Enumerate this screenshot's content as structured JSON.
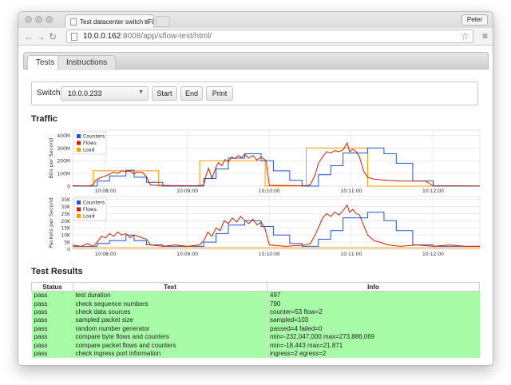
{
  "browser": {
    "tab_title": "Test datacenter switch sFlo",
    "user_button": "Peter",
    "url_host": "10.0.0.162",
    "url_path": ":8008/app/sflow-test/html/"
  },
  "page_tabs": [
    {
      "label": "Tests",
      "active": true
    },
    {
      "label": "Instructions",
      "active": false
    }
  ],
  "controls": {
    "switch_label": "Switch",
    "switch_value": "10.0.0.233",
    "start_label": "Start",
    "end_label": "End",
    "print_label": "Print"
  },
  "traffic_heading": "Traffic",
  "results_heading": "Test Results",
  "chart_data": [
    {
      "type": "line",
      "ylabel": "Bits per Second",
      "ylim": [
        0,
        440
      ],
      "yticks": [
        {
          "v": 0,
          "label": "0"
        },
        {
          "v": 100,
          "label": "100M"
        },
        {
          "v": 200,
          "label": "200M"
        },
        {
          "v": 300,
          "label": "300M"
        },
        {
          "v": 400,
          "label": "400M"
        }
      ],
      "xlim": [
        0,
        497
      ],
      "xticks": [
        {
          "v": 40,
          "label": "10:08:00"
        },
        {
          "v": 140,
          "label": "10:09:00"
        },
        {
          "v": 240,
          "label": "10:10:00"
        },
        {
          "v": 340,
          "label": "10:11:00"
        },
        {
          "v": 440,
          "label": "10:12:00"
        }
      ],
      "legend": "top-left",
      "series": [
        {
          "name": "Counters",
          "color": "#2255cc",
          "points": [
            [
              0,
              0
            ],
            [
              30,
              0
            ],
            [
              30,
              40
            ],
            [
              45,
              40
            ],
            [
              45,
              80
            ],
            [
              65,
              80
            ],
            [
              65,
              125
            ],
            [
              75,
              125
            ],
            [
              75,
              70
            ],
            [
              90,
              70
            ],
            [
              90,
              30
            ],
            [
              110,
              30
            ],
            [
              110,
              0
            ],
            [
              160,
              0
            ],
            [
              160,
              60
            ],
            [
              175,
              60
            ],
            [
              175,
              135
            ],
            [
              190,
              135
            ],
            [
              190,
              220
            ],
            [
              210,
              220
            ],
            [
              210,
              255
            ],
            [
              230,
              255
            ],
            [
              230,
              200
            ],
            [
              245,
              200
            ],
            [
              245,
              120
            ],
            [
              265,
              120
            ],
            [
              265,
              45
            ],
            [
              280,
              45
            ],
            [
              280,
              0
            ],
            [
              300,
              0
            ],
            [
              300,
              90
            ],
            [
              315,
              90
            ],
            [
              315,
              160
            ],
            [
              330,
              160
            ],
            [
              330,
              260
            ],
            [
              360,
              260
            ],
            [
              360,
              300
            ],
            [
              380,
              300
            ],
            [
              380,
              255
            ],
            [
              395,
              255
            ],
            [
              395,
              180
            ],
            [
              415,
              180
            ],
            [
              415,
              40
            ],
            [
              440,
              40
            ],
            [
              440,
              0
            ],
            [
              497,
              0
            ]
          ]
        },
        {
          "name": "Flows",
          "color": "#cc2200",
          "points": [
            [
              0,
              3
            ],
            [
              20,
              2
            ],
            [
              25,
              10
            ],
            [
              28,
              45
            ],
            [
              35,
              70
            ],
            [
              40,
              80
            ],
            [
              45,
              95
            ],
            [
              50,
              110
            ],
            [
              55,
              100
            ],
            [
              60,
              120
            ],
            [
              65,
              115
            ],
            [
              70,
              118
            ],
            [
              75,
              95
            ],
            [
              78,
              110
            ],
            [
              85,
              108
            ],
            [
              90,
              75
            ],
            [
              95,
              8
            ],
            [
              125,
              4
            ],
            [
              150,
              3
            ],
            [
              160,
              8
            ],
            [
              163,
              90
            ],
            [
              166,
              140
            ],
            [
              170,
              60
            ],
            [
              175,
              150
            ],
            [
              178,
              185
            ],
            [
              182,
              160
            ],
            [
              186,
              210
            ],
            [
              190,
              190
            ],
            [
              194,
              230
            ],
            [
              198,
              215
            ],
            [
              202,
              240
            ],
            [
              206,
              225
            ],
            [
              210,
              250
            ],
            [
              215,
              220
            ],
            [
              220,
              240
            ],
            [
              225,
              205
            ],
            [
              230,
              230
            ],
            [
              236,
              200
            ],
            [
              240,
              6
            ],
            [
              270,
              4
            ],
            [
              285,
              3
            ],
            [
              290,
              10
            ],
            [
              296,
              90
            ],
            [
              300,
              180
            ],
            [
              305,
              230
            ],
            [
              310,
              270
            ],
            [
              315,
              260
            ],
            [
              320,
              280
            ],
            [
              325,
              270
            ],
            [
              330,
              285
            ],
            [
              335,
              340
            ],
            [
              338,
              270
            ],
            [
              342,
              290
            ],
            [
              346,
              270
            ],
            [
              350,
              230
            ],
            [
              355,
              120
            ],
            [
              360,
              70
            ],
            [
              368,
              55
            ],
            [
              375,
              50
            ],
            [
              385,
              45
            ],
            [
              400,
              40
            ],
            [
              430,
              40
            ],
            [
              440,
              3
            ],
            [
              497,
              2
            ]
          ]
        },
        {
          "name": "Load",
          "color": "#ff9900",
          "points": [
            [
              0,
              0
            ],
            [
              25,
              0
            ],
            [
              25,
              120
            ],
            [
              105,
              120
            ],
            [
              105,
              0
            ],
            [
              155,
              0
            ],
            [
              155,
              200
            ],
            [
              235,
              200
            ],
            [
              235,
              0
            ],
            [
              285,
              0
            ],
            [
              285,
              300
            ],
            [
              360,
              300
            ],
            [
              360,
              0
            ],
            [
              497,
              0
            ]
          ]
        }
      ]
    },
    {
      "type": "line",
      "ylabel": "Packets per Second",
      "ylim": [
        0,
        37
      ],
      "yticks": [
        {
          "v": 0,
          "label": "0"
        },
        {
          "v": 5,
          "label": "5K"
        },
        {
          "v": 10,
          "label": "10K"
        },
        {
          "v": 15,
          "label": "15K"
        },
        {
          "v": 20,
          "label": "20K"
        },
        {
          "v": 25,
          "label": "25K"
        },
        {
          "v": 30,
          "label": "30K"
        },
        {
          "v": 35,
          "label": "35K"
        }
      ],
      "xlim": [
        0,
        497
      ],
      "xticks": [
        {
          "v": 40,
          "label": "10:08:00"
        },
        {
          "v": 140,
          "label": "10:09:00"
        },
        {
          "v": 240,
          "label": "10:10:00"
        },
        {
          "v": 340,
          "label": "10:11:00"
        },
        {
          "v": 440,
          "label": "10:12:00"
        }
      ],
      "legend": "top-left",
      "series": [
        {
          "name": "Counters",
          "color": "#2255cc",
          "points": [
            [
              0,
              2
            ],
            [
              30,
              2
            ],
            [
              30,
              4
            ],
            [
              45,
              4
            ],
            [
              45,
              6
            ],
            [
              65,
              6
            ],
            [
              65,
              10
            ],
            [
              75,
              10
            ],
            [
              75,
              6
            ],
            [
              90,
              6
            ],
            [
              90,
              3
            ],
            [
              110,
              3
            ],
            [
              110,
              2
            ],
            [
              160,
              2
            ],
            [
              160,
              5
            ],
            [
              175,
              5
            ],
            [
              175,
              11
            ],
            [
              190,
              11
            ],
            [
              190,
              17
            ],
            [
              210,
              17
            ],
            [
              210,
              20
            ],
            [
              230,
              20
            ],
            [
              230,
              16
            ],
            [
              245,
              16
            ],
            [
              245,
              10
            ],
            [
              265,
              10
            ],
            [
              265,
              4
            ],
            [
              280,
              4
            ],
            [
              280,
              2
            ],
            [
              300,
              2
            ],
            [
              300,
              7
            ],
            [
              315,
              7
            ],
            [
              315,
              13
            ],
            [
              330,
              13
            ],
            [
              330,
              22
            ],
            [
              360,
              22
            ],
            [
              360,
              26
            ],
            [
              380,
              26
            ],
            [
              380,
              20
            ],
            [
              395,
              20
            ],
            [
              395,
              13
            ],
            [
              415,
              13
            ],
            [
              415,
              3
            ],
            [
              440,
              3
            ],
            [
              440,
              2
            ],
            [
              497,
              2
            ]
          ]
        },
        {
          "name": "Flows",
          "color": "#cc2200",
          "points": [
            [
              0,
              3
            ],
            [
              10,
              2
            ],
            [
              18,
              4
            ],
            [
              25,
              2
            ],
            [
              30,
              5
            ],
            [
              35,
              9
            ],
            [
              40,
              8
            ],
            [
              45,
              11
            ],
            [
              50,
              9
            ],
            [
              55,
              12
            ],
            [
              60,
              10
            ],
            [
              65,
              11
            ],
            [
              70,
              8
            ],
            [
              75,
              10
            ],
            [
              80,
              9
            ],
            [
              90,
              7
            ],
            [
              95,
              3
            ],
            [
              110,
              2
            ],
            [
              125,
              3
            ],
            [
              140,
              2
            ],
            [
              155,
              3
            ],
            [
              160,
              6
            ],
            [
              165,
              12
            ],
            [
              170,
              9
            ],
            [
              175,
              15
            ],
            [
              180,
              13
            ],
            [
              185,
              20
            ],
            [
              190,
              18
            ],
            [
              195,
              22
            ],
            [
              200,
              19
            ],
            [
              205,
              23
            ],
            [
              210,
              20
            ],
            [
              215,
              18
            ],
            [
              220,
              21
            ],
            [
              225,
              17
            ],
            [
              230,
              19
            ],
            [
              235,
              14
            ],
            [
              240,
              3
            ],
            [
              260,
              2
            ],
            [
              285,
              3
            ],
            [
              290,
              4
            ],
            [
              296,
              10
            ],
            [
              300,
              15
            ],
            [
              305,
              22
            ],
            [
              310,
              25
            ],
            [
              315,
              23
            ],
            [
              320,
              26
            ],
            [
              325,
              24
            ],
            [
              330,
              27
            ],
            [
              335,
              31
            ],
            [
              338,
              26
            ],
            [
              342,
              28
            ],
            [
              346,
              25
            ],
            [
              350,
              24
            ],
            [
              355,
              17
            ],
            [
              360,
              10
            ],
            [
              368,
              6
            ],
            [
              375,
              5
            ],
            [
              385,
              3
            ],
            [
              400,
              2
            ],
            [
              420,
              3
            ],
            [
              440,
              2
            ],
            [
              460,
              3
            ],
            [
              480,
              2
            ],
            [
              497,
              2
            ]
          ]
        },
        {
          "name": "Load",
          "color": "#ff9900",
          "points": [
            [
              0,
              1
            ],
            [
              497,
              1
            ]
          ]
        }
      ]
    }
  ],
  "results_table": {
    "headers": [
      "Status",
      "Test",
      "Info"
    ],
    "rows": [
      {
        "status": "pass",
        "test": "test duration",
        "info": "497"
      },
      {
        "status": "pass",
        "test": "check sequence numbers",
        "info": "790"
      },
      {
        "status": "pass",
        "test": "check data sources",
        "info": "counter=53 flow=2"
      },
      {
        "status": "pass",
        "test": "sampled packet size",
        "info": "sampled=103"
      },
      {
        "status": "pass",
        "test": "random number generator",
        "info": "passed=4 failed=0"
      },
      {
        "status": "pass",
        "test": "compare byte flows and counters",
        "info": "min=-232,047,000 max=273,886,069"
      },
      {
        "status": "pass",
        "test": "compare packet flows and counters",
        "info": "min=-18,443 max=21,871"
      },
      {
        "status": "pass",
        "test": "check ingress port information",
        "info": "ingress=2 egress=2"
      }
    ]
  }
}
